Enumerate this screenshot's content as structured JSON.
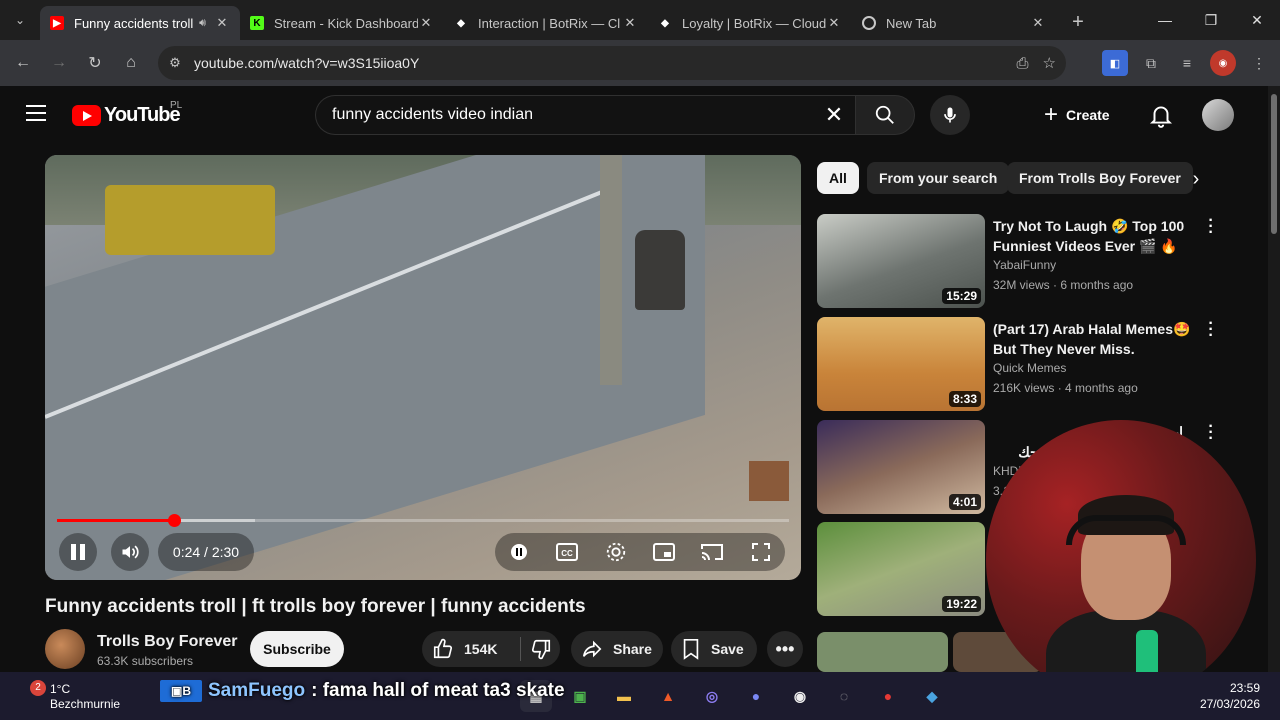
{
  "browser": {
    "tabs": [
      {
        "title": "Funny accidents troll",
        "favicon": "youtube-favicon",
        "active": true,
        "audio": true
      },
      {
        "title": "Stream - Kick Dashboard",
        "favicon": "kick-favicon"
      },
      {
        "title": "Interaction | BotRix — Cl",
        "favicon": "botrix-favicon"
      },
      {
        "title": "Loyalty | BotRix — Cloud",
        "favicon": "botrix-favicon"
      },
      {
        "title": "New Tab",
        "favicon": "chrome-favicon"
      }
    ],
    "url": "youtube.com/watch?v=w3S15iioa0Y"
  },
  "youtube": {
    "logo_text": "YouTube",
    "country_code": "PL",
    "search_query": "funny accidents video indian",
    "create_label": "Create"
  },
  "player": {
    "current_time": "0:24 / 2:30",
    "progress": 0.16,
    "buffered": 0.27
  },
  "video": {
    "title": "Funny accidents troll | ft trolls boy forever | funny accidents",
    "channel_name": "Trolls Boy Forever",
    "subscribers": "63.3K subscribers",
    "subscribe_label": "Subscribe",
    "likes": "154K",
    "share_label": "Share",
    "save_label": "Save"
  },
  "sidebar": {
    "chips": [
      "All",
      "From your search",
      "From Trolls Boy Forever"
    ],
    "recommendations": [
      {
        "title": "Try Not To Laugh 🤣 Top 100 Funniest Videos Ever 🎬 🔥 ...",
        "channel": "YabaiFunny",
        "meta": "32M views · 6 months ago",
        "duration": "15:29"
      },
      {
        "title": "(Part 17) Arab Halal Memes🤩 But They Never Miss.",
        "channel": "Quick Memes",
        "meta": "216K views · 4 months ago",
        "duration": "8:33"
      },
      {
        "title": "ابيخ نكتة بالعالم .. هههههههههههههه وف واضحك",
        "channel": "KHD77",
        "meta": "3.1M",
        "duration": "4:01"
      },
      {
        "title": "",
        "channel": "",
        "meta": "",
        "duration": "19:22"
      }
    ]
  },
  "taskbar": {
    "weather_temp": "1°C",
    "weather_location": "Bezchmurnie",
    "notification_count": "2",
    "ticker_user": "SamFuego",
    "ticker_message": ": fama hall of meat ta3 skate",
    "time": "23:59",
    "date": "27/03/2026"
  },
  "colors": {
    "youtube_red": "#ff0000",
    "kick_green": "#53fc18",
    "page_bg": "#0f0f0f"
  }
}
